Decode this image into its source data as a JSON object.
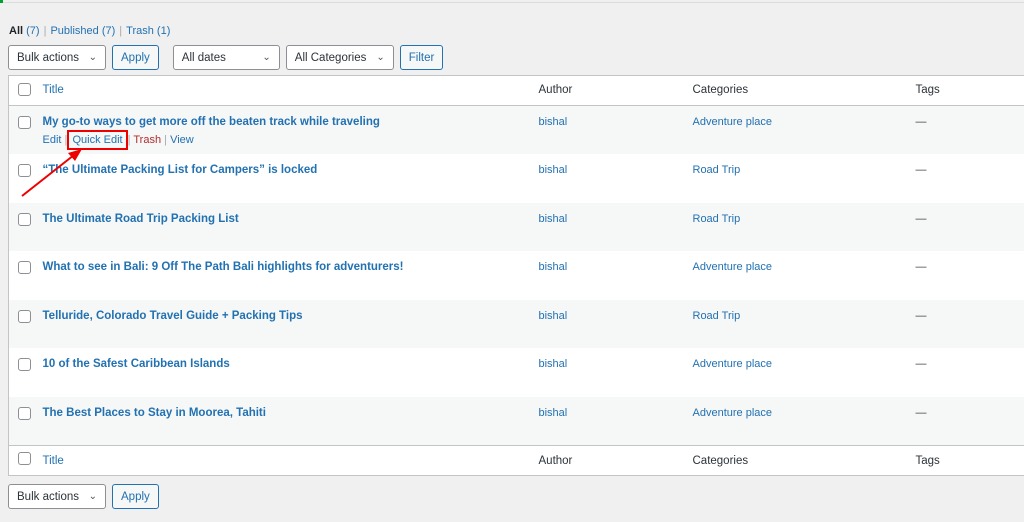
{
  "filters": {
    "all": "All",
    "all_count": "(7)",
    "published": "Published",
    "published_count": "(7)",
    "trash": "Trash",
    "trash_count": "(1)"
  },
  "toolbar": {
    "bulk": "Bulk actions",
    "apply": "Apply",
    "dates": "All dates",
    "categories": "All Categories",
    "filter": "Filter"
  },
  "columns": {
    "title": "Title",
    "author": "Author",
    "categories": "Categories",
    "tags": "Tags"
  },
  "row_actions": {
    "edit": "Edit",
    "quick_edit": "Quick Edit",
    "trash": "Trash",
    "view": "View"
  },
  "posts": [
    {
      "title": "My go-to ways to get more off the beaten track while traveling",
      "author": "bishal",
      "category": "Adventure place",
      "tags": "—"
    },
    {
      "title": "“The Ultimate Packing List for Campers” is locked",
      "author": "bishal",
      "category": "Road Trip",
      "tags": "—"
    },
    {
      "title": "The Ultimate Road Trip Packing List",
      "author": "bishal",
      "category": "Road Trip",
      "tags": "—"
    },
    {
      "title": "What to see in Bali: 9 Off The Path Bali highlights for adventurers!",
      "author": "bishal",
      "category": "Adventure place",
      "tags": "—"
    },
    {
      "title": "Telluride, Colorado Travel Guide + Packing Tips",
      "author": "bishal",
      "category": "Road Trip",
      "tags": "—"
    },
    {
      "title": "10 of the Safest Caribbean Islands",
      "author": "bishal",
      "category": "Adventure place",
      "tags": "—"
    },
    {
      "title": "The Best Places to Stay in Moorea, Tahiti",
      "author": "bishal",
      "category": "Adventure place",
      "tags": "—"
    }
  ],
  "colors": {
    "link": "#2271b1",
    "trash": "#b32d2e",
    "highlight": "#e00000"
  }
}
